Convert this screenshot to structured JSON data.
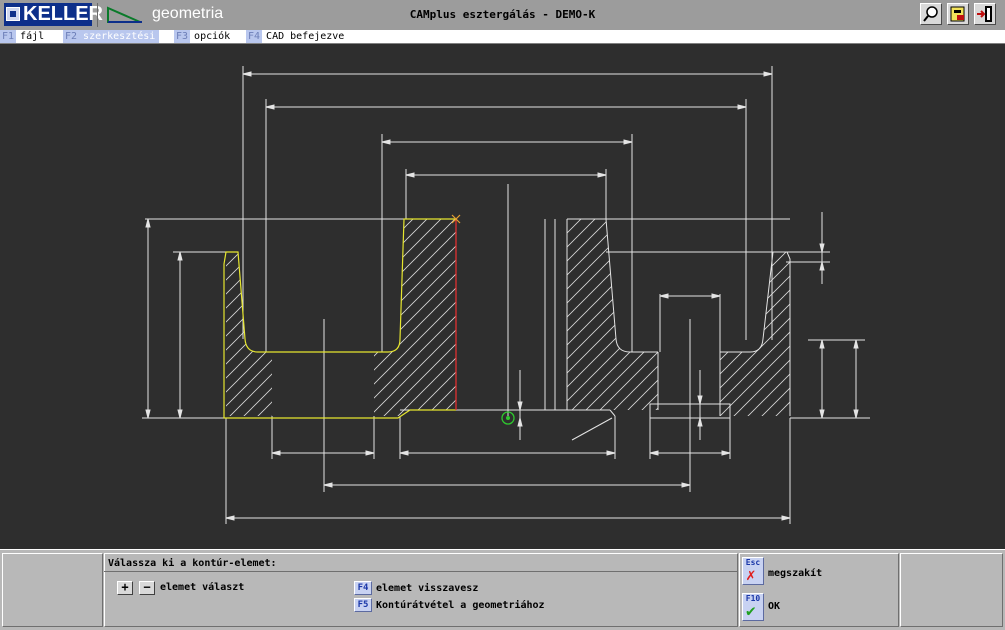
{
  "app": {
    "brand": "KELLER",
    "module": "geometria",
    "title": "CAMplus esztergálás - DEMO-K"
  },
  "toolbar": {
    "icons": [
      "zoom-icon",
      "edit-tool-icon",
      "exit-icon"
    ]
  },
  "menu": [
    {
      "key": "F1",
      "label": "fájl",
      "active": false
    },
    {
      "key": "F2",
      "label": "szerkesztési",
      "active": true
    },
    {
      "key": "F3",
      "label": "opciók",
      "active": false
    },
    {
      "key": "F4",
      "label": "CAD befejezve",
      "active": false
    }
  ],
  "bottom": {
    "prompt": "Válassza ki a kontúr-elemet:",
    "plus_label": "+",
    "minus_label": "−",
    "select_label": "elemet választ",
    "f4_key": "F4",
    "f4_label": "elemet visszavesz",
    "f5_key": "F5",
    "f5_label": "Kontúrátvétel a geometriához",
    "esc_key": "Esc",
    "esc_label": "megszakít",
    "f10_key": "F10",
    "f10_label": "OK"
  },
  "colors": {
    "canvas": "#2e2e2e",
    "lines": "#e4e4e4",
    "contour": "#e6e62e",
    "selected": "#e03030",
    "origin": "#2ec92e",
    "cancel": "#e02020",
    "ok": "#20a020"
  }
}
